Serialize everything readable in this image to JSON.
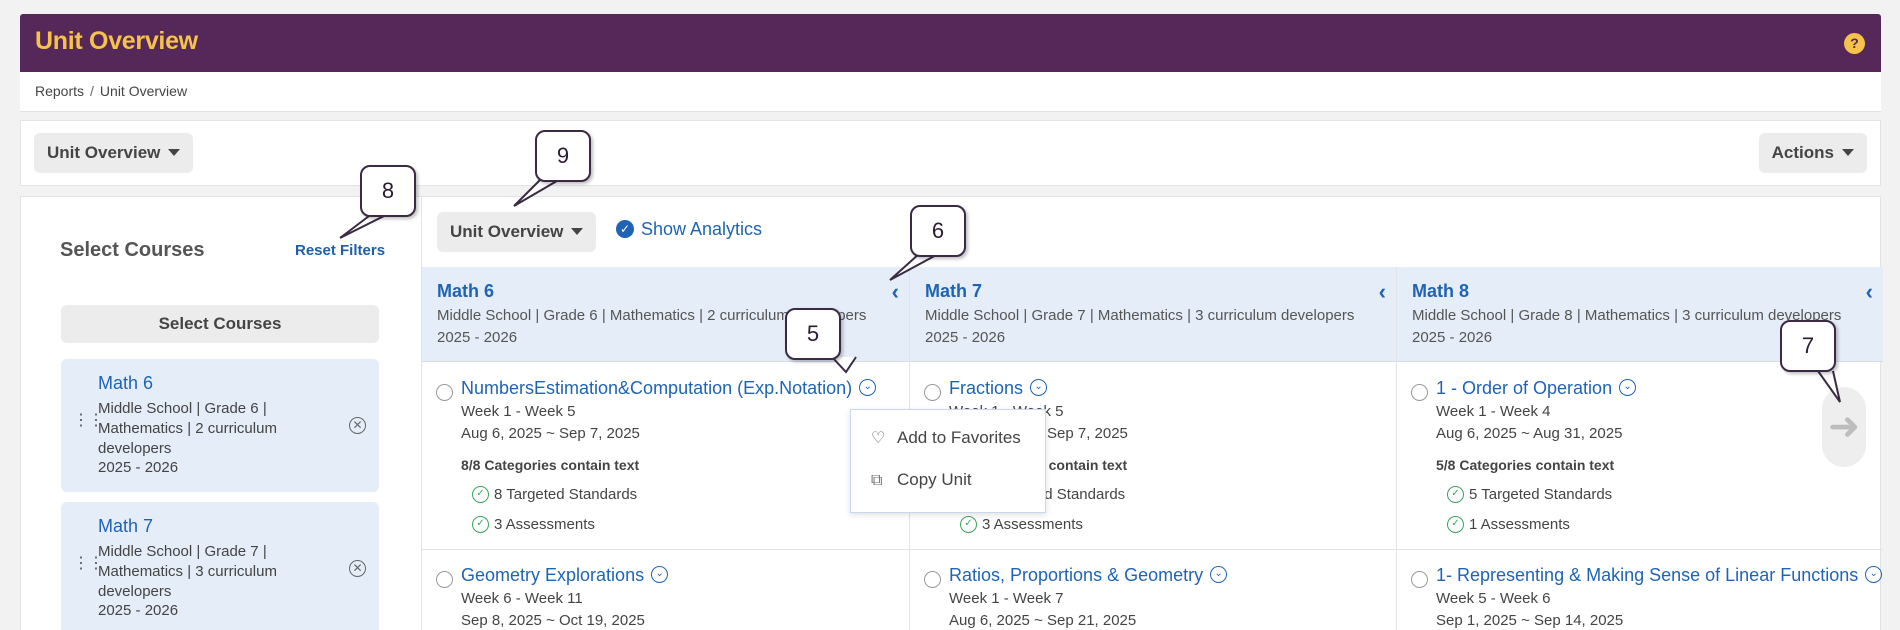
{
  "header": {
    "title": "Unit Overview",
    "help_icon": "question-icon"
  },
  "breadcrumb": {
    "items": [
      "Reports",
      "Unit Overview"
    ],
    "separator": "/"
  },
  "toolbar": {
    "view_label": "Unit Overview",
    "actions_label": "Actions"
  },
  "left": {
    "heading": "Select Courses",
    "reset_label": "Reset Filters",
    "select_button": "Select Courses",
    "courses": [
      {
        "name": "Math 6",
        "desc": "Middle School | Grade 6 | Mathematics | 2 curriculum developers",
        "year": "2025 - 2026"
      },
      {
        "name": "Math 7",
        "desc": "Middle School | Grade 7 | Mathematics | 3 curriculum developers",
        "year": "2025 - 2026"
      }
    ]
  },
  "main": {
    "view_label": "Unit Overview",
    "show_analytics": "Show Analytics",
    "columns": [
      {
        "name": "Math 6",
        "desc": "Middle School | Grade 6 | Mathematics | 2 curriculum developers",
        "year": "2025 - 2026",
        "units": [
          {
            "name": "NumbersEstimation&Computation (Exp.Notation)",
            "weeks": "Week 1 - Week 5",
            "dates": "Aug 6, 2025 ~ Sep 7, 2025",
            "categories": "8/8 Categories contain text",
            "standards": "8 Targeted Standards",
            "assessments": "3 Assessments"
          },
          {
            "name": "Geometry Explorations",
            "weeks": "Week 6 - Week 11",
            "dates": "Sep 8, 2025 ~ Oct 19, 2025"
          }
        ]
      },
      {
        "name": "Math 7",
        "desc": "Middle School | Grade 7 | Mathematics | 3 curriculum developers",
        "year": "2025 - 2026",
        "units": [
          {
            "name": "Fractions",
            "weeks": "Week 1 - Week 5",
            "dates": "Aug 6, 2025 ~ Sep 7, 2025",
            "categories": "8/8 Categories contain text",
            "standards": "8 Targeted Standards",
            "assessments": "3 Assessments"
          },
          {
            "name": "Ratios, Proportions & Geometry",
            "weeks": "Week 1 - Week 7",
            "dates": "Aug 6, 2025 ~ Sep 21, 2025"
          }
        ]
      },
      {
        "name": "Math 8",
        "desc": "Middle School | Grade 8 | Mathematics | 3 curriculum developers",
        "year": "2025 - 2026",
        "units": [
          {
            "name": "1 - Order of Operation",
            "weeks": "Week 1 - Week 4",
            "dates": "Aug 6, 2025 ~ Aug 31, 2025",
            "categories": "5/8 Categories contain text",
            "standards": "5 Targeted Standards",
            "assessments": "1 Assessments"
          },
          {
            "name": "1- Representing & Making Sense of Linear Functions",
            "weeks": "Week 5 - Week 6",
            "dates": "Sep 1, 2025 ~ Sep 14, 2025"
          }
        ]
      }
    ]
  },
  "menu": {
    "items": [
      "Add to Favorites",
      "Copy Unit"
    ]
  },
  "callouts": [
    "5",
    "6",
    "7",
    "8",
    "9"
  ],
  "colors": {
    "header_bg": "#56285a",
    "title": "#f5c24a",
    "link": "#1f64b4",
    "success": "#3aa55a"
  }
}
